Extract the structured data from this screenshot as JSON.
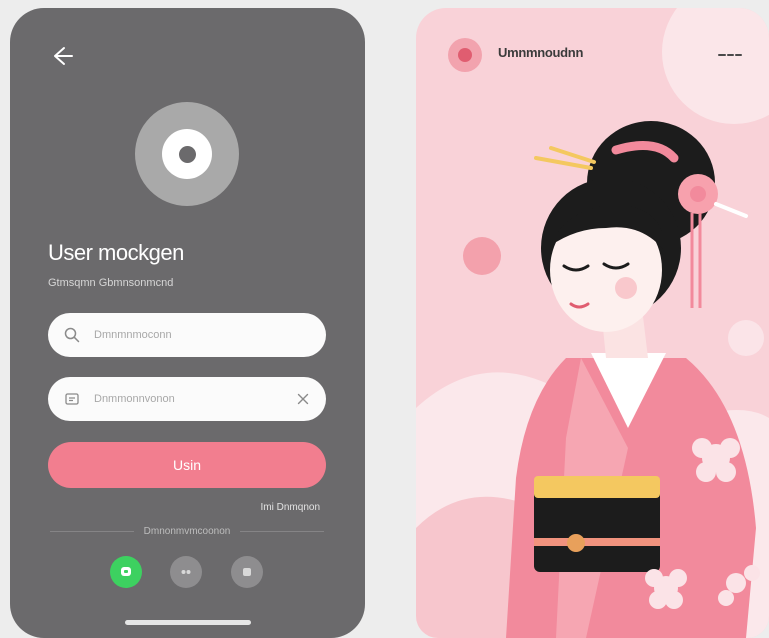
{
  "login": {
    "title": "User mockgen",
    "subtitle": "Gtmsqmn Gbmnsonmcnd",
    "search_placeholder": "Dmnmnmoconn",
    "password_placeholder": "Dnmmonnvonon",
    "login_label": "Usin",
    "forgot_label": "Imi Dnmqnon",
    "divider_label": "Dmnonmvmcoonon"
  },
  "profile": {
    "title": "Umnmnoudnn"
  },
  "colors": {
    "left_panel": "#6b6a6c",
    "accent_pink": "#f27e8f",
    "right_panel": "#f9d2d8",
    "social_green": "#3dd160"
  },
  "icons": {
    "back": "arrow-left-icon",
    "search": "search-icon",
    "field2": "message-icon",
    "clear": "close-icon",
    "social": [
      "chat-icon",
      "dots-icon",
      "square-icon"
    ],
    "menu": "more-icon"
  }
}
